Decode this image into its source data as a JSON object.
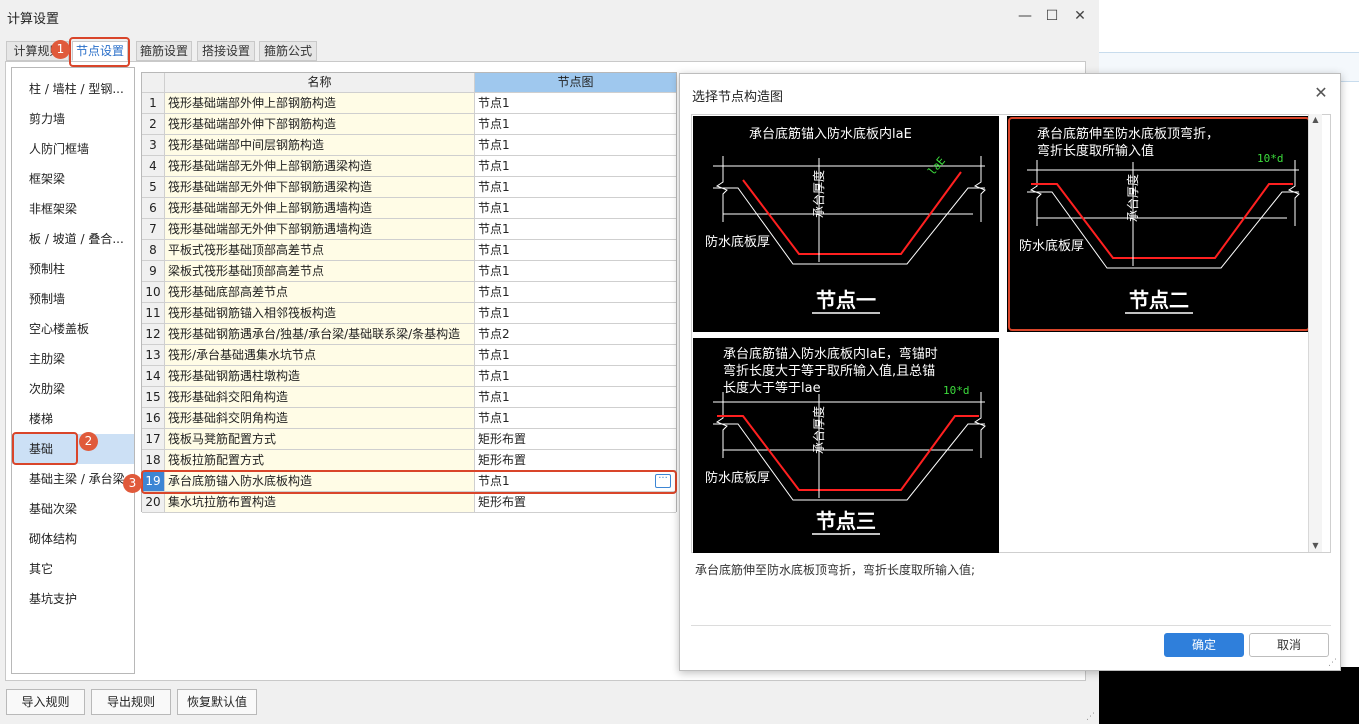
{
  "window": {
    "title": "计算设置",
    "tabs": [
      "计算规则",
      "节点设置",
      "箍筋设置",
      "搭接设置",
      "箍筋公式"
    ]
  },
  "sidebar": {
    "items": [
      "柱 / 墙柱 / 型钢...",
      "剪力墙",
      "人防门框墙",
      "框架梁",
      "非框架梁",
      "板 / 坡道 / 叠合...",
      "预制柱",
      "预制墙",
      "空心楼盖板",
      "主肋梁",
      "次肋梁",
      "楼梯",
      "基础",
      "基础主梁 / 承台梁",
      "基础次梁",
      "砌体结构",
      "其它",
      "基坑支护"
    ],
    "selected": "基础"
  },
  "grid": {
    "headers": {
      "name": "名称",
      "node": "节点图"
    },
    "rows": [
      {
        "no": "1",
        "name": "筏形基础端部外伸上部钢筋构造",
        "node": "节点1"
      },
      {
        "no": "2",
        "name": "筏形基础端部外伸下部钢筋构造",
        "node": "节点1"
      },
      {
        "no": "3",
        "name": "筏形基础端部中间层钢筋构造",
        "node": "节点1"
      },
      {
        "no": "4",
        "name": "筏形基础端部无外伸上部钢筋遇梁构造",
        "node": "节点1"
      },
      {
        "no": "5",
        "name": "筏形基础端部无外伸下部钢筋遇梁构造",
        "node": "节点1"
      },
      {
        "no": "6",
        "name": "筏形基础端部无外伸上部钢筋遇墙构造",
        "node": "节点1"
      },
      {
        "no": "7",
        "name": "筏形基础端部无外伸下部钢筋遇墙构造",
        "node": "节点1"
      },
      {
        "no": "8",
        "name": "平板式筏形基础顶部高差节点",
        "node": "节点1"
      },
      {
        "no": "9",
        "name": "梁板式筏形基础顶部高差节点",
        "node": "节点1"
      },
      {
        "no": "10",
        "name": "筏形基础底部高差节点",
        "node": "节点1"
      },
      {
        "no": "11",
        "name": "筏形基础钢筋锚入相邻筏板构造",
        "node": "节点1"
      },
      {
        "no": "12",
        "name": "筏形基础钢筋遇承台/独基/承台梁/基础联系梁/条基构造",
        "node": "节点2"
      },
      {
        "no": "13",
        "name": "筏形/承台基础遇集水坑节点",
        "node": "节点1"
      },
      {
        "no": "14",
        "name": "筏形基础钢筋遇柱墩构造",
        "node": "节点1"
      },
      {
        "no": "15",
        "name": "筏形基础斜交阳角构造",
        "node": "节点1"
      },
      {
        "no": "16",
        "name": "筏形基础斜交阴角构造",
        "node": "节点1"
      },
      {
        "no": "17",
        "name": "筏板马凳筋配置方式",
        "node": "矩形布置"
      },
      {
        "no": "18",
        "name": "筏板拉筋配置方式",
        "node": "矩形布置"
      },
      {
        "no": "19",
        "name": "承台底筋锚入防水底板构造",
        "node": "节点1"
      },
      {
        "no": "20",
        "name": "集水坑拉筋布置构造",
        "node": "矩形布置"
      }
    ],
    "selected_row": "19"
  },
  "dialog": {
    "title": "选择节点构造图",
    "nodes": [
      {
        "caption": "节点一",
        "line1": "承台底筋锚入防水底板内laE",
        "line2": "",
        "line3": "",
        "dim": "laE",
        "left_label": "防水底板厚",
        "center_label": "承台厚度"
      },
      {
        "caption": "节点二",
        "line1": "承台底筋伸至防水底板顶弯折，",
        "line2": "弯折长度取所输入值",
        "line3": "",
        "dim": "10*d",
        "left_label": "防水底板厚",
        "center_label": "承台厚度"
      },
      {
        "caption": "节点三",
        "line1": "承台底筋锚入防水底板内laE，弯锚时",
        "line2": "弯折长度大于等于取所输入值,且总锚",
        "line3": "长度大于等于lae",
        "dim": "10*d",
        "left_label": "防水底板厚",
        "center_label": "承台厚度"
      }
    ],
    "selected_node": "节点二",
    "description": "承台底筋伸至防水底板顶弯折，弯折长度取所输入值;",
    "ok_label": "确定",
    "cancel_label": "取消"
  },
  "footer": {
    "import_label": "导入规则",
    "export_label": "导出规则",
    "restore_label": "恢复默认值"
  },
  "badges": [
    "1",
    "2",
    "3"
  ],
  "colors": {
    "accent": "#2f7fdb",
    "highlight": "#d9452a",
    "rebar": "#ff2020",
    "dim": "#3cdc3c"
  }
}
